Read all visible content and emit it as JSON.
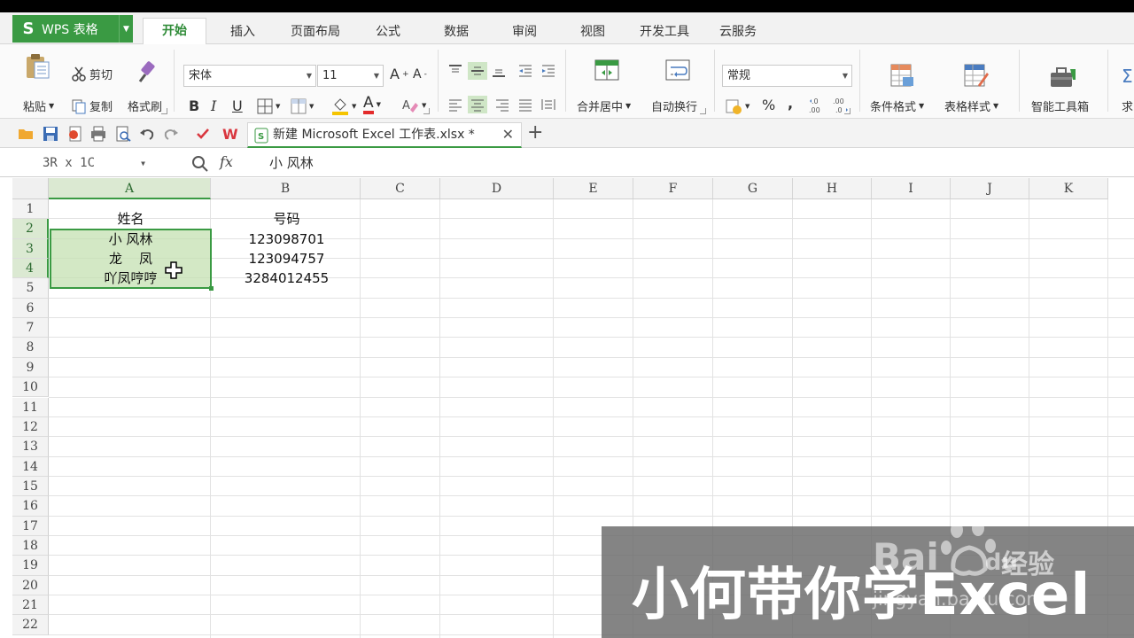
{
  "app": {
    "name": "WPS 表格",
    "brand_color": "#3a9a43"
  },
  "menu": {
    "tabs": [
      "开始",
      "插入",
      "页面布局",
      "公式",
      "数据",
      "审阅",
      "视图",
      "开发工具",
      "云服务"
    ],
    "active_tab": "开始"
  },
  "ribbon": {
    "clipboard": {
      "paste": "粘贴",
      "cut": "剪切",
      "copy": "复制",
      "format_painter": "格式刷"
    },
    "font": {
      "family": "宋体",
      "size": "11",
      "bold": "B",
      "italic": "I",
      "underline": "U",
      "font_color_letter": "A"
    },
    "alignment": {
      "merge_center": "合并居中",
      "wrap_text": "自动换行"
    },
    "number": {
      "format": "常规",
      "percent": "%",
      "comma": ","
    },
    "styles": {
      "conditional_format": "条件格式",
      "table_style": "表格样式",
      "smart_toolbox": "智能工具箱",
      "partial": "求"
    }
  },
  "document": {
    "tab_title": "新建 Microsoft Excel 工作表.xlsx *"
  },
  "formula_bar": {
    "name_box": "3R x 1C",
    "fx": "fx",
    "content": "小 风林"
  },
  "sheet": {
    "columns": [
      "A",
      "B",
      "C",
      "D",
      "E",
      "F",
      "G",
      "H",
      "I",
      "J",
      "K"
    ],
    "rows": [
      "1",
      "2",
      "3",
      "4",
      "5",
      "6",
      "7",
      "8",
      "9",
      "10",
      "11",
      "12",
      "13",
      "14",
      "15",
      "16",
      "17",
      "18",
      "19",
      "20",
      "21",
      "22"
    ],
    "cells": {
      "A1": "姓名",
      "B1": "号码",
      "A2": "小 风林",
      "B2": "123098701",
      "A3": "龙    凤",
      "B3": "123094757",
      "A4": "吖凤哼哼",
      "B4": "3284012455"
    },
    "selection": "A2:A4"
  },
  "watermark": {
    "title": "小何带你学Excel",
    "baidu": "Bai",
    "baidu_du": "du",
    "jingyan": "经验",
    "url": "jingyan.baidu.com"
  }
}
